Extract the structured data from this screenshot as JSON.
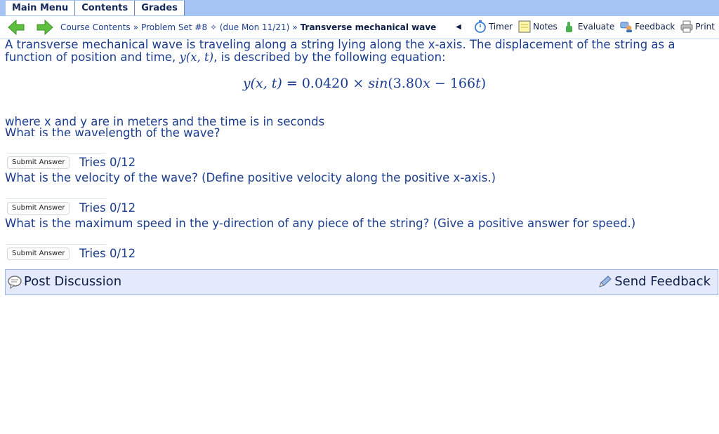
{
  "topnav": {
    "main_menu": "Main Menu",
    "contents": "Contents",
    "grades": "Grades"
  },
  "breadcrumb": {
    "course_contents": "Course Contents",
    "sep": "»",
    "problem_set": "Problem Set #8",
    "due_marker": "✧",
    "due": "(due Mon 11/21)",
    "current": "Transverse mechanical wave"
  },
  "tools": {
    "collapse_arrow": "◀",
    "timer": "Timer",
    "notes": "Notes",
    "evaluate": "Evaluate",
    "feedback": "Feedback",
    "print": "Print"
  },
  "problem": {
    "intro_line1": "A transverse mechanical wave is traveling along a string lying along the x-axis. The displacement of the string as a",
    "intro_line2_pre": "function of position and time, ",
    "intro_line2_math": "y(x, t)",
    "intro_line2_post": ", is described by the following equation:",
    "equation_lhs": "y(x, t)",
    "equation_eq": " = 0.0420 × ",
    "equation_func": "sin",
    "equation_arg_open": "(3.80",
    "equation_x": "x",
    "equation_minus": " − 166",
    "equation_t": "t",
    "equation_close": ")",
    "units_note": "where x and y are in meters and the time is in seconds"
  },
  "questions": [
    {
      "text": "What is the wavelength of the wave?",
      "answer": "",
      "submit_label": "Submit Answer",
      "tries": "Tries 0/12"
    },
    {
      "text": "What is the velocity of the wave? (Define positive velocity along the positive x-axis.)",
      "answer": "",
      "submit_label": "Submit Answer",
      "tries": "Tries 0/12"
    },
    {
      "text": "What is the maximum speed in the y-direction of any piece of the string? (Give a positive answer for speed.)",
      "answer": "",
      "submit_label": "Submit Answer",
      "tries": "Tries 0/12"
    }
  ],
  "footer": {
    "post_discussion": "Post Discussion",
    "send_feedback": "Send Feedback"
  },
  "colors": {
    "topbar": "#a6c4f3",
    "text": "#1a3d8f",
    "footer_bg": "#e4e9fc",
    "arrow_green": "#5fbf3f"
  }
}
